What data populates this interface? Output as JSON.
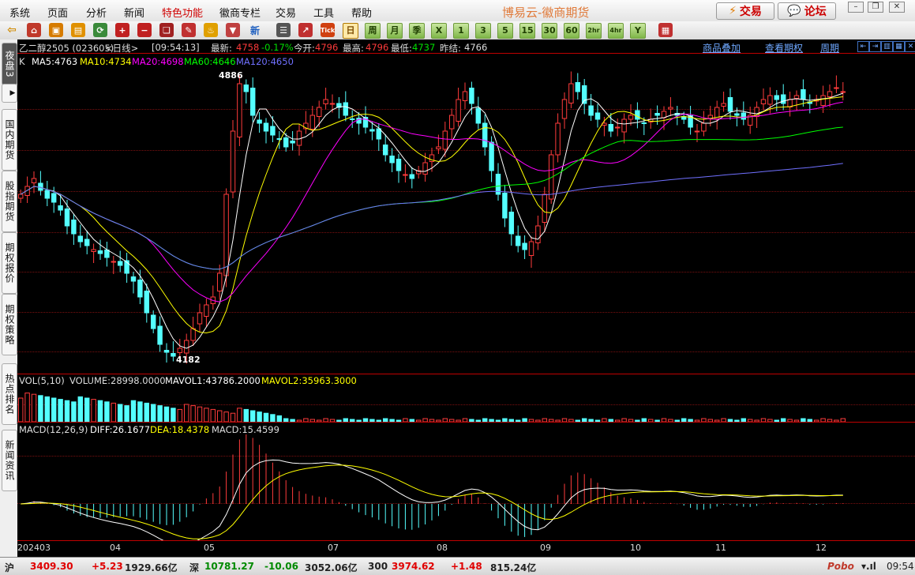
{
  "menu": {
    "items": [
      "系统",
      "页面",
      "分析",
      "新闻",
      "特色功能",
      "徽商专栏",
      "交易",
      "工具",
      "帮助"
    ],
    "hot_index": 4,
    "brand": "博易云-徽商期货",
    "trade_button": "交易",
    "forum_button": "论坛"
  },
  "toolbar": {
    "periods": [
      "日",
      "周",
      "月",
      "季",
      "X",
      "1",
      "3",
      "5",
      "15",
      "30",
      "60",
      "2hr",
      "4hr",
      "Y"
    ],
    "active_period": "日"
  },
  "left_tabs": [
    "夜盘3",
    "国内期货",
    "股指期货",
    "期权报价",
    "期权策略",
    "热点排名",
    "新闻资讯"
  ],
  "chart_header": {
    "name": "乙二醇2505 (023605)",
    "period": "<日线>",
    "time": "[09:54:13]",
    "latest_label": "最新:",
    "latest": "4758",
    "change": "-0.17%",
    "open_label": "今开:",
    "open": "4796",
    "high_label": "最高:",
    "high": "4796",
    "low_label": "最低:",
    "low": "4737",
    "prev_label": "昨结:",
    "prev": "4766",
    "links": [
      "商品叠加",
      "查看期权",
      "周期"
    ]
  },
  "ma_legend": {
    "k": "K",
    "ma5": "MA5:4763",
    "ma10": "MA10:4734",
    "ma20": "MA20:4698",
    "ma60": "MA60:4646",
    "ma120": "MA120:4650"
  },
  "vol_legend": {
    "name": "VOL(5,10)",
    "volume": "VOLUME:28998.0000",
    "mavol1": "MAVOL1:43786.2000",
    "mavol2": "MAVOL2:35963.3000"
  },
  "macd_legend": {
    "name": "MACD(12,26,9)",
    "diff": "DIFF:26.1677",
    "dea": "DEA:18.4378",
    "macd": "MACD:15.4599"
  },
  "colors": {
    "up": "#ff3b3b",
    "down": "#54ffff",
    "ma5": "#ffffff",
    "ma10": "#ffff00",
    "ma20": "#ff00ff",
    "ma60": "#00ff00",
    "ma120": "#7070ff"
  },
  "chart_data": {
    "type": "candlestick",
    "high_annotation": "4886",
    "low_annotation": "4182",
    "x_labels": [
      "202403",
      "04",
      "05",
      "07",
      "08",
      "09",
      "10",
      "11",
      "12"
    ],
    "candles_close": [
      4600,
      4620,
      4640,
      4610,
      4590,
      4580,
      4560,
      4520,
      4500,
      4480,
      4470,
      4460,
      4450,
      4440,
      4430,
      4420,
      4400,
      4380,
      4340,
      4300,
      4260,
      4220,
      4200,
      4190,
      4210,
      4230,
      4260,
      4300,
      4320,
      4340,
      4400,
      4600,
      4760,
      4880,
      4860,
      4800,
      4780,
      4760,
      4750,
      4740,
      4720,
      4730,
      4760,
      4780,
      4800,
      4820,
      4840,
      4830,
      4820,
      4800,
      4790,
      4780,
      4770,
      4760,
      4740,
      4700,
      4680,
      4660,
      4650,
      4640,
      4660,
      4680,
      4700,
      4720,
      4760,
      4800,
      4840,
      4860,
      4830,
      4780,
      4720,
      4660,
      4600,
      4540,
      4500,
      4470,
      4460,
      4480,
      4520,
      4600,
      4700,
      4780,
      4840,
      4880,
      4860,
      4830,
      4800,
      4790,
      4780,
      4760,
      4770,
      4790,
      4800,
      4790,
      4780,
      4790,
      4800,
      4810,
      4820,
      4800,
      4790,
      4770,
      4760,
      4780,
      4800,
      4820,
      4830,
      4810,
      4800,
      4790,
      4800,
      4820,
      4840,
      4850,
      4840,
      4830,
      4840,
      4850,
      4840,
      4830,
      4840,
      4850,
      4860,
      4870,
      4860
    ],
    "volume_legend": {
      "volume": 28998.0,
      "mavol1": 43786.2,
      "mavol2": 35963.3
    },
    "macd_values": {
      "diff": 26.1677,
      "dea": 18.4378,
      "macd": 15.4599
    }
  },
  "statusbar": {
    "sh_label": "沪",
    "sh_price": "3409.30",
    "sh_change": "+5.23",
    "sh_amount": "1929.66亿",
    "sz_label": "深",
    "sz_price": "10781.27",
    "sz_change": "-10.06",
    "sz_amount": "3052.06亿",
    "i300_label": "300",
    "i300_price": "3974.62",
    "i300_change": "+1.48",
    "i300_amount": "815.24亿",
    "brand": "Pobo",
    "time": "09:54"
  }
}
